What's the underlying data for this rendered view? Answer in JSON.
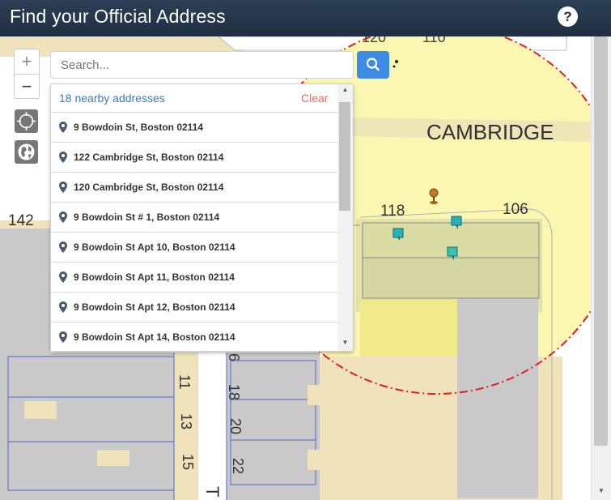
{
  "header": {
    "title": "Find your Official Address",
    "help_label": "?"
  },
  "search": {
    "placeholder": "Search..."
  },
  "results": {
    "count_label": "18 nearby addresses",
    "clear_label": "Clear",
    "items": [
      "9 Bowdoin St, Boston 02114",
      "122 Cambridge St, Boston 02114",
      "120 Cambridge St, Boston 02114",
      "9 Bowdoin St # 1, Boston 02114",
      "9 Bowdoin St Apt 10, Boston 02114",
      "9 Bowdoin St Apt 11, Boston 02114",
      "9 Bowdoin St Apt 12, Boston 02114",
      "9 Bowdoin St Apt 14, Boston 02114"
    ]
  },
  "map": {
    "street_label": "CAMBRIDGE",
    "street_numbers": [
      "120",
      "110",
      "142",
      "118",
      "106",
      "11",
      "13",
      "15",
      "6",
      "18",
      "20",
      "22",
      "T"
    ],
    "zoom_in": "+",
    "zoom_out": "−",
    "colors": {
      "parcel_gray": "#c9c9c9",
      "road_tan": "#f0e3bb",
      "buffer_yellow": "#fbf7b0",
      "buffer_ring": "#e02020",
      "parcel_line": "#5566cc",
      "search_button": "#3d8ce3",
      "header": "#233349"
    }
  }
}
